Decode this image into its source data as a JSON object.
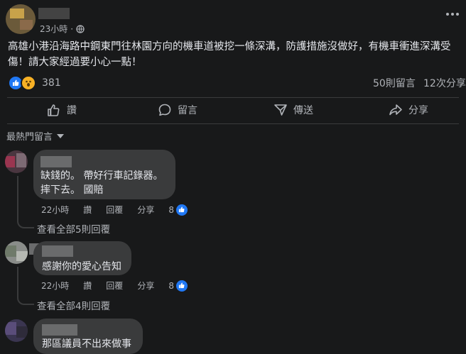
{
  "post": {
    "timestamp": "23小時",
    "text": "高雄小港沿海路中鋼東門往林園方向的機車道被挖一條深溝，防護措施沒做好，有機車衝進深溝受傷！請大家經過要小心一點！",
    "reaction_count": "381",
    "comment_count": "50則留言",
    "share_count": "12次分享"
  },
  "actions": {
    "like": "讚",
    "comment": "留言",
    "send": "傳送",
    "share": "分享"
  },
  "sort": {
    "label": "最熱門留言"
  },
  "comments": [
    {
      "text_line1": "缺錢的。 帶好行車記錄器。",
      "text_line2": "摔下去。 國賠",
      "time": "22小時",
      "like": "讚",
      "reply": "回覆",
      "share": "分享",
      "likes": "8",
      "view_replies": "查看全部5則回覆"
    },
    {
      "text_line1": "感謝你的愛心告知",
      "time": "22小時",
      "like": "讚",
      "reply": "回覆",
      "share": "分享",
      "likes": "8",
      "view_replies": "查看全部4則回覆"
    },
    {
      "text_line1": "那區議員不出來做事"
    }
  ],
  "colors": {
    "background": "#18191a",
    "bubble": "#3a3b3c",
    "text": "#e4e6eb",
    "muted": "#b0b3b8",
    "like_blue": "#2078f4",
    "wow_yellow": "#f7b125"
  },
  "icons": {
    "globe": "globe-icon",
    "more": "more-horizontal-icon",
    "like": "thumbs-up-icon",
    "comment": "speech-bubble-icon",
    "send": "send-icon",
    "share": "share-arrow-icon",
    "sort": "caret-down-icon"
  }
}
